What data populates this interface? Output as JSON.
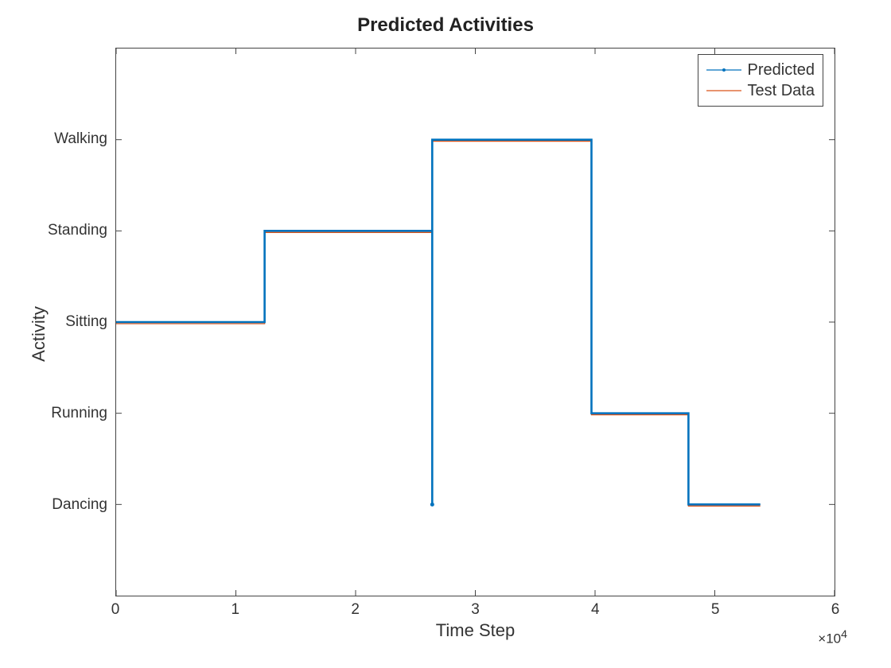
{
  "chart_data": {
    "type": "line",
    "title": "Predicted Activities",
    "xlabel": "Time Step",
    "ylabel": "Activity",
    "x_exponent_label": "×10",
    "x_exponent_power": "4",
    "xlim": [
      0,
      60000
    ],
    "ylim_categories_index_range": [
      0,
      6
    ],
    "xticks": [
      0,
      10000,
      20000,
      30000,
      40000,
      50000,
      60000
    ],
    "xtick_labels": [
      "0",
      "1",
      "2",
      "3",
      "4",
      "5",
      "6"
    ],
    "y_categories": [
      "Dancing",
      "Running",
      "Sitting",
      "Standing",
      "Walking"
    ],
    "series": [
      {
        "name": "Predicted",
        "color": "#0072BD",
        "marker": "dot",
        "segments": [
          {
            "x": [
              0,
              12400
            ],
            "cat": "Sitting"
          },
          {
            "transition": true,
            "x": 12400,
            "from": "Sitting",
            "to": "Standing"
          },
          {
            "x": [
              12400,
              26300
            ],
            "cat": "Standing"
          },
          {
            "spike": true,
            "x": 26400,
            "from": "Standing",
            "to": "Dancing"
          },
          {
            "x": [
              26400,
              39700
            ],
            "cat": "Walking"
          },
          {
            "transition": true,
            "x": 39700,
            "from": "Walking",
            "to": "Running"
          },
          {
            "x": [
              39700,
              47800
            ],
            "cat": "Running"
          },
          {
            "transition": true,
            "x": 47800,
            "from": "Running",
            "to": "Dancing"
          },
          {
            "x": [
              47800,
              53800
            ],
            "cat": "Dancing"
          }
        ]
      },
      {
        "name": "Test Data",
        "color": "#D95319",
        "segments": [
          {
            "x": [
              0,
              12400
            ],
            "cat": "Sitting"
          },
          {
            "transition": true,
            "x": 12400,
            "from": "Sitting",
            "to": "Standing"
          },
          {
            "x": [
              12400,
              26400
            ],
            "cat": "Standing"
          },
          {
            "transition": true,
            "x": 26400,
            "from": "Standing",
            "to": "Walking"
          },
          {
            "x": [
              26400,
              39700
            ],
            "cat": "Walking"
          },
          {
            "transition": true,
            "x": 39700,
            "from": "Walking",
            "to": "Running"
          },
          {
            "x": [
              39700,
              47800
            ],
            "cat": "Running"
          },
          {
            "transition": true,
            "x": 47800,
            "from": "Running",
            "to": "Dancing"
          },
          {
            "x": [
              47800,
              53800
            ],
            "cat": "Dancing"
          }
        ]
      }
    ],
    "legend": {
      "position": "top-right",
      "entries": [
        "Predicted",
        "Test Data"
      ]
    }
  }
}
